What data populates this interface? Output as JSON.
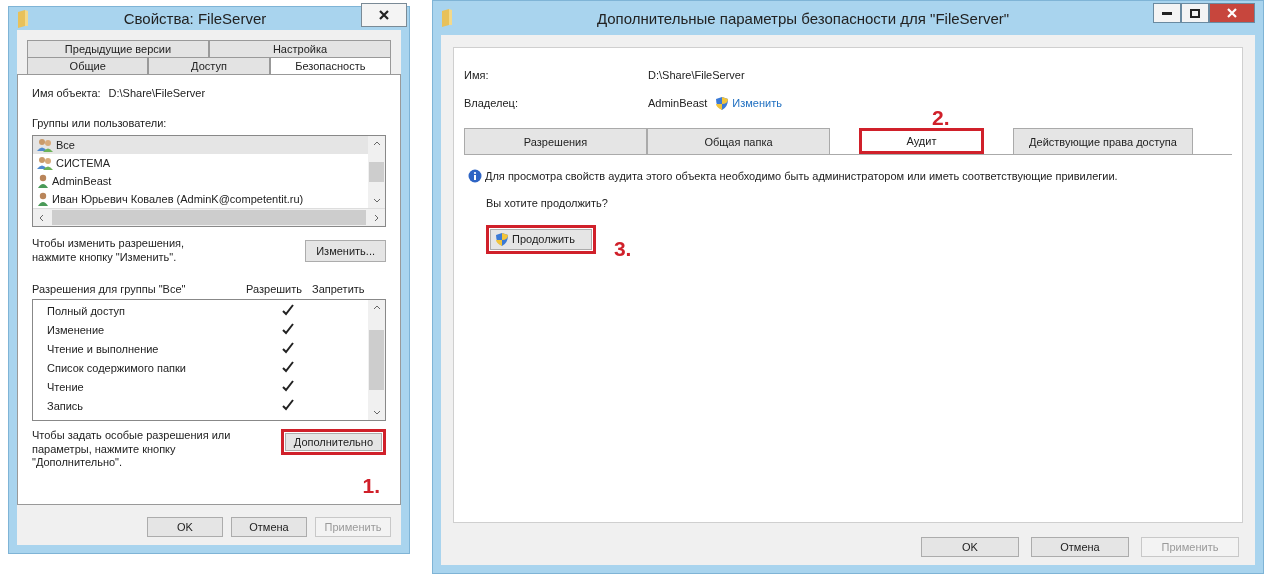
{
  "left_window": {
    "title": "Свойства: FileServer",
    "tab_rows": [
      [
        {
          "label": "Предыдущие версии",
          "selected": false
        },
        {
          "label": "Настройка",
          "selected": false
        }
      ],
      [
        {
          "label": "Общие",
          "selected": false
        },
        {
          "label": "Доступ",
          "selected": false
        },
        {
          "label": "Безопасность",
          "selected": true
        }
      ]
    ],
    "object_name_label": "Имя объекта:",
    "object_name": "D:\\Share\\FileServer",
    "groups_label": "Группы или пользователи:",
    "groups": [
      {
        "name": "Все",
        "kind": "group",
        "selected": true
      },
      {
        "name": "СИСТЕМА",
        "kind": "group",
        "selected": false
      },
      {
        "name": "AdminBeast",
        "kind": "user",
        "selected": false
      },
      {
        "name": "Иван Юрьевич Ковалев (AdminK@competentit.ru)",
        "kind": "user",
        "selected": false
      }
    ],
    "change_hint": "Чтобы изменить разрешения, нажмите кнопку \"Изменить\".",
    "change_button": "Изменить...",
    "permissions_header": "Разрешения для группы \"Все\"",
    "allow_header": "Разрешить",
    "deny_header": "Запретить",
    "permissions": [
      {
        "name": "Полный доступ",
        "allow": true,
        "deny": false
      },
      {
        "name": "Изменение",
        "allow": true,
        "deny": false
      },
      {
        "name": "Чтение и выполнение",
        "allow": true,
        "deny": false
      },
      {
        "name": "Список содержимого папки",
        "allow": true,
        "deny": false
      },
      {
        "name": "Чтение",
        "allow": true,
        "deny": false
      },
      {
        "name": "Запись",
        "allow": true,
        "deny": false
      }
    ],
    "advanced_hint": "Чтобы задать особые разрешения или параметры, нажмите кнопку \"Дополнительно\".",
    "advanced_button": {
      "label": "Дополнительно",
      "highlighted": true
    },
    "step": "1.",
    "buttons": [
      {
        "label": "OK",
        "disabled": false
      },
      {
        "label": "Отмена",
        "disabled": false
      },
      {
        "label": "Применить",
        "disabled": true
      }
    ]
  },
  "right_window": {
    "title": "Дополнительные параметры безопасности  для \"FileServer\"",
    "name_label": "Имя:",
    "name_value": "D:\\Share\\FileServer",
    "owner_label": "Владелец:",
    "owner_value": "AdminBeast",
    "owner_link": "Изменить",
    "step_2": "2.",
    "tabs": [
      {
        "label": "Разрешения",
        "selected": false,
        "highlighted": false
      },
      {
        "label": "Общая папка",
        "selected": false,
        "highlighted": false
      },
      {
        "label": "Аудит",
        "selected": true,
        "highlighted": true
      },
      {
        "label": "Действующие права доступа",
        "selected": false,
        "highlighted": false
      }
    ],
    "info": "Для просмотра свойств аудита этого объекта необходимо быть администратором или иметь соответствующие привилегии.",
    "question": "Вы хотите продолжить?",
    "continue_button": {
      "label": "Продолжить",
      "highlighted": true
    },
    "step_3": "3.",
    "buttons": [
      {
        "label": "OK",
        "disabled": false
      },
      {
        "label": "Отмена",
        "disabled": false
      },
      {
        "label": "Применить",
        "disabled": true
      }
    ]
  }
}
